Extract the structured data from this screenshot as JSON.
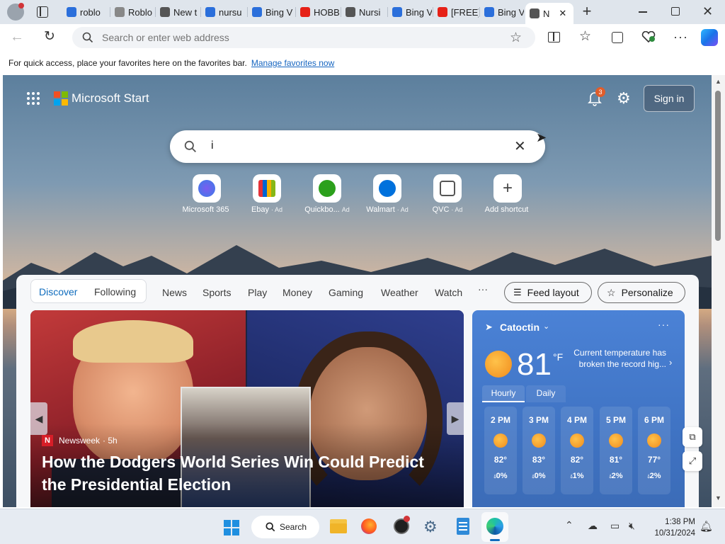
{
  "tabs": [
    {
      "label": "roblo",
      "icon": "bing-search-icon",
      "color": "#2b6fdb"
    },
    {
      "label": "Roblo",
      "icon": "cloud-page-icon",
      "color": "#888888"
    },
    {
      "label": "New t",
      "icon": "new-tab-icon",
      "color": "#555555"
    },
    {
      "label": "nursu",
      "icon": "bing-search-icon",
      "color": "#2b6fdb"
    },
    {
      "label": "Bing V",
      "icon": "bing-search-icon",
      "color": "#2b6fdb"
    },
    {
      "label": "HOBB",
      "icon": "youtube-icon",
      "color": "#e62117"
    },
    {
      "label": "Nursi",
      "icon": "document-icon",
      "color": "#555555"
    },
    {
      "label": "Bing V",
      "icon": "bing-search-icon",
      "color": "#2b6fdb"
    },
    {
      "label": "[FREE]",
      "icon": "youtube-icon",
      "color": "#e62117"
    },
    {
      "label": "Bing V",
      "icon": "bing-search-icon",
      "color": "#2b6fdb"
    },
    {
      "label": "N",
      "icon": "new-tab-icon",
      "color": "#555555"
    }
  ],
  "address": {
    "placeholder": "Search or enter web address"
  },
  "favbar": {
    "message": "For quick access, place your favorites here on the favorites bar.",
    "link": "Manage favorites now"
  },
  "header": {
    "brand": "Microsoft Start",
    "notification_count": "3",
    "sign_in": "Sign in"
  },
  "search": {
    "value": "i"
  },
  "shortcuts": [
    {
      "label": "Microsoft 365",
      "ad": "",
      "icon": "microsoft365-icon"
    },
    {
      "label": "Ebay",
      "ad": "· Ad",
      "icon": "ebay-icon"
    },
    {
      "label": "Quickbo...",
      "ad": "Ad",
      "icon": "quickbooks-icon"
    },
    {
      "label": "Walmart",
      "ad": "· Ad",
      "icon": "walmart-icon"
    },
    {
      "label": "QVC",
      "ad": "· Ad",
      "icon": "qvc-icon"
    },
    {
      "label": "Add shortcut",
      "ad": "",
      "icon": "plus-icon"
    }
  ],
  "feed": {
    "pill_tabs": [
      "Discover",
      "Following"
    ],
    "tabs": [
      "News",
      "Sports",
      "Play",
      "Money",
      "Gaming",
      "Weather",
      "Watch"
    ],
    "more": "···",
    "feed_layout": "Feed layout",
    "personalize": "Personalize"
  },
  "hero": {
    "source_logo": "N",
    "source": "Newsweek",
    "age": "· 5h",
    "headline": "How the Dodgers World Series Win Could Predict the Presidential Election"
  },
  "weather": {
    "location": "Catoctin",
    "temp": "81",
    "unit": "°F",
    "alert": "Current temperature has broken the record hig...",
    "tabs": [
      "Hourly",
      "Daily"
    ],
    "hours": [
      {
        "time": "2 PM",
        "temp": "82°",
        "precip": "0%"
      },
      {
        "time": "3 PM",
        "temp": "83°",
        "precip": "0%"
      },
      {
        "time": "4 PM",
        "temp": "82°",
        "precip": "1%"
      },
      {
        "time": "5 PM",
        "temp": "81°",
        "precip": "2%"
      },
      {
        "time": "6 PM",
        "temp": "77°",
        "precip": "2%"
      }
    ]
  },
  "taskbar": {
    "search": "Search",
    "time": "1:38 PM",
    "date": "10/31/2024"
  },
  "colors": {
    "accent": "#0f6cbd",
    "weather": "#4b82d6",
    "sun": "#f08b1c"
  }
}
